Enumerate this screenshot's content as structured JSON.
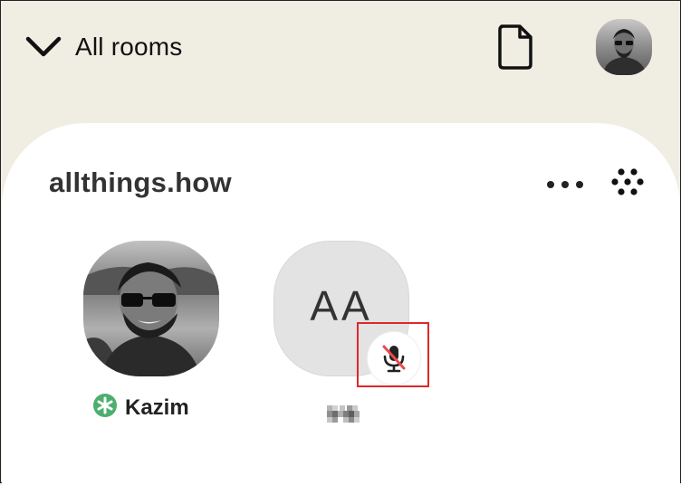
{
  "header": {
    "back_label": "All rooms",
    "icons": {
      "back": "chevron-down-icon",
      "document": "document-icon",
      "profile": "profile-avatar"
    }
  },
  "room": {
    "title": "allthings.how",
    "icons": {
      "more": "more-dots-icon",
      "grid": "grid-dots-icon"
    }
  },
  "speakers": [
    {
      "name": "Kazim",
      "badge": "moderator-asterisk-icon",
      "badge_color": "#4caf6e"
    },
    {
      "initials": "AA",
      "name": "",
      "status_icon": "mic-muted-icon"
    }
  ],
  "colors": {
    "background": "#f0ede3",
    "sheet": "#ffffff",
    "highlight": "#e0262b",
    "muted_slash": "#e84a4a"
  }
}
